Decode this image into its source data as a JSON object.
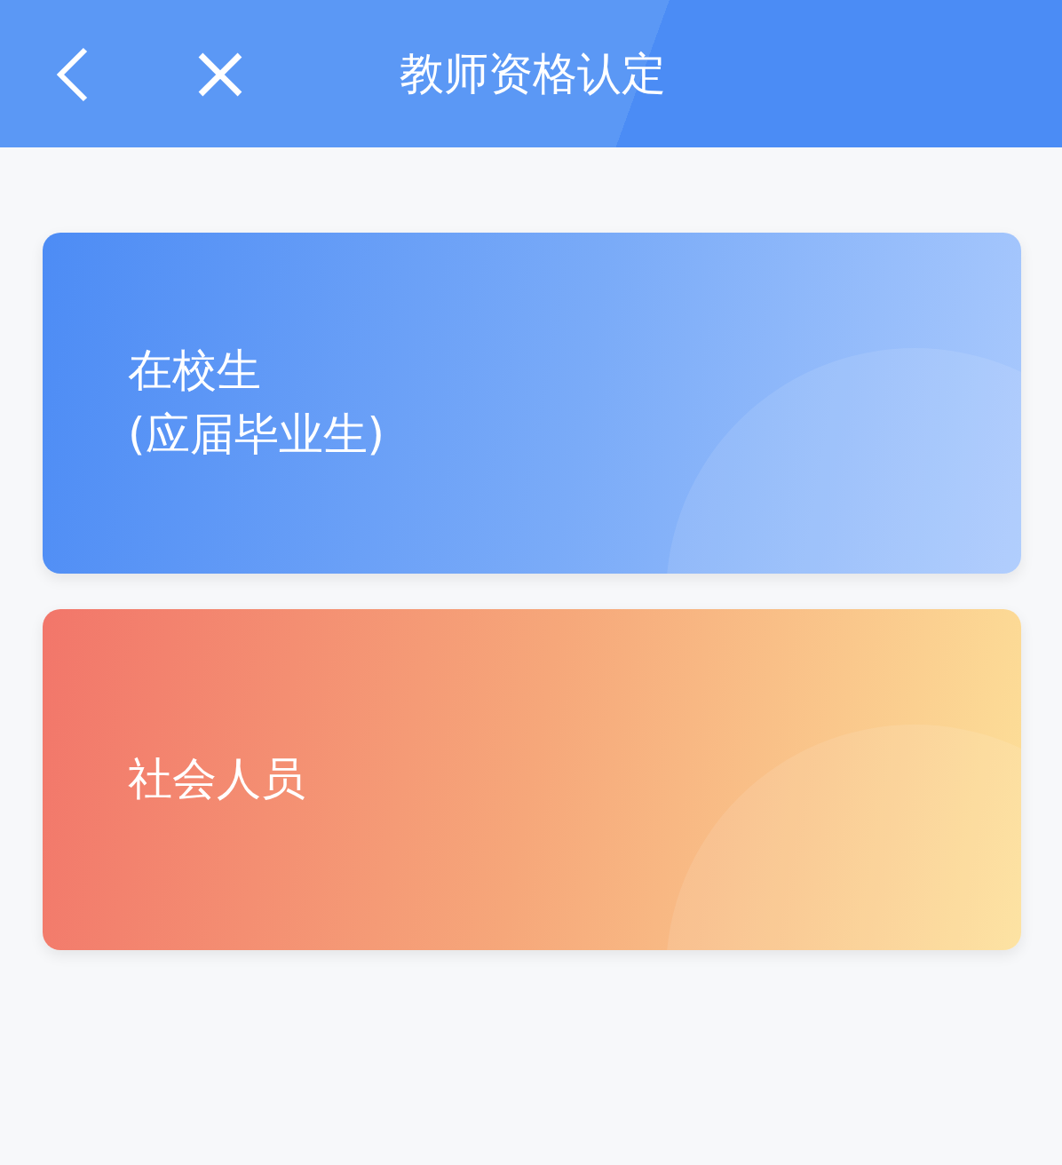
{
  "header": {
    "title": "教师资格认定"
  },
  "options": [
    {
      "kind": "blue",
      "lines": [
        "在校生",
        "(应届毕业生)"
      ]
    },
    {
      "kind": "orange",
      "lines": [
        "社会人员"
      ]
    }
  ]
}
